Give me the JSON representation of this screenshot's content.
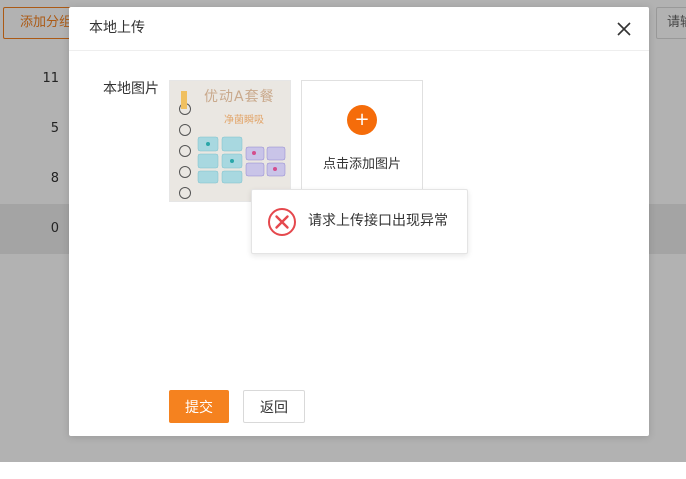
{
  "background": {
    "add_group_label": "添加分组",
    "search_label": "请输",
    "row_values": [
      "11",
      "5",
      "8",
      "0"
    ]
  },
  "modal": {
    "title": "本地上传",
    "field_label": "本地图片",
    "thumbnail": {
      "title_text": "优动A套餐",
      "subtitle_text": "净菌瞬吸"
    },
    "upload_text": "点击添加图片",
    "toast_message": "请求上传接口出现异常",
    "submit_label": "提交",
    "back_label": "返回"
  },
  "colors": {
    "accent": "#f5821f",
    "plus_button": "#f56c0a",
    "error": "#e5484d"
  },
  "icons": [
    "close-icon",
    "plus-icon",
    "error-icon"
  ]
}
